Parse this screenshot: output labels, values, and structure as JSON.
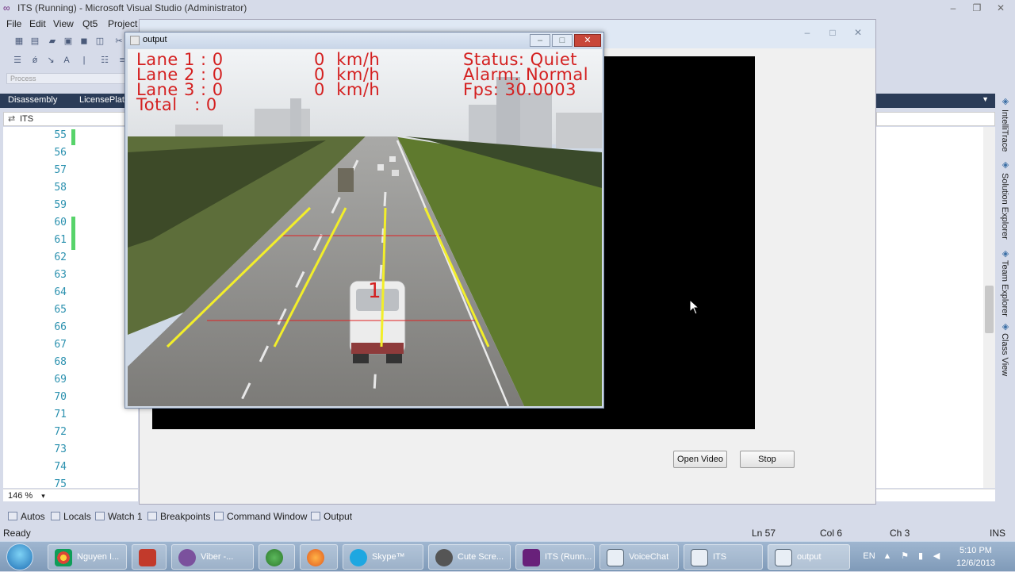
{
  "vs": {
    "title": "ITS (Running) - Microsoft Visual Studio (Administrator)",
    "menu": [
      "File",
      "Edit",
      "View",
      "Qt5",
      "Project"
    ],
    "config_placeholder": "Process",
    "doc_tabs": [
      "Disassembly",
      "LicensePlat"
    ],
    "scope": "ITS",
    "line_numbers": [
      "55",
      "56",
      "57",
      "58",
      "59",
      "60",
      "61",
      "62",
      "63",
      "64",
      "65",
      "66",
      "67",
      "68",
      "69",
      "70",
      "71",
      "72",
      "73",
      "74",
      "75"
    ],
    "zoom": "146 %",
    "side_panels": [
      "IntelliTrace",
      "Solution Explorer",
      "Team Explorer",
      "Class View"
    ]
  },
  "output_window": {
    "title": "output",
    "overlay": {
      "lane1": "Lane 1 : 0",
      "lane2": "Lane 2 : 0",
      "lane3": "Lane 3 : 0",
      "total": "Total   : 0",
      "speed1": "0  km/h",
      "speed2": "0  km/h",
      "speed3": "0  km/h",
      "status": "Status: Quiet",
      "alarm": "Alarm: Normal",
      "fps": "Fps: 30.0003",
      "vehicle_id": "1"
    }
  },
  "qt_dialog": {
    "open_video": "Open Video",
    "stop": "Stop"
  },
  "bottom_tabs": [
    "Autos",
    "Locals",
    "Watch 1",
    "Breakpoints",
    "Command Window",
    "Output"
  ],
  "status": {
    "ready": "Ready",
    "ln": "Ln 57",
    "col": "Col 6",
    "ch": "Ch 3",
    "ins": "INS"
  },
  "taskbar": {
    "items": [
      "Nguyen I...",
      "Viber -...",
      "Skype™",
      "Cute Scre...",
      "ITS (Runn...",
      "VoiceChat",
      "ITS",
      "output"
    ],
    "time": "5:10 PM",
    "date": "12/6/2013",
    "lang": "EN"
  },
  "colors": {
    "lane_line": "#f2ee2a",
    "overlay_text": "#d42020",
    "detect_line": "#e02020"
  }
}
